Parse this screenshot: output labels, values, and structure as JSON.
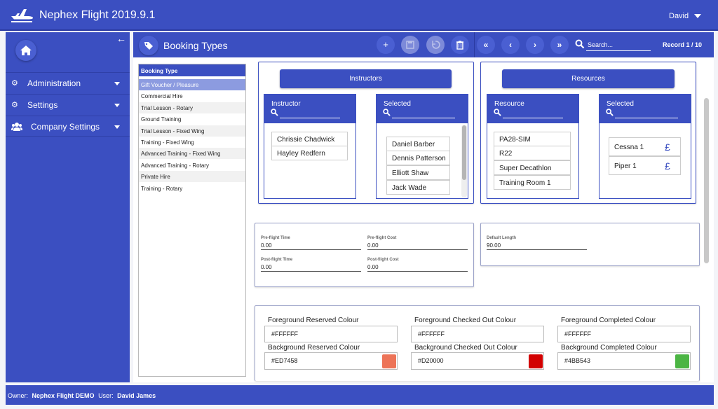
{
  "app": {
    "title": "Nephex Flight 2019.9.1",
    "user": "David"
  },
  "nav": {
    "items": [
      {
        "label": "Administration",
        "icon": "gear-icon"
      },
      {
        "label": "Settings",
        "icon": "gears-icon"
      },
      {
        "label": "Company Settings",
        "icon": "users-icon"
      }
    ]
  },
  "toolbar": {
    "title": "Booking Types",
    "search_placeholder": "Search...",
    "record": "Record 1 / 10"
  },
  "list": {
    "header": "Booking Type",
    "items": [
      "Gift Voucher / Pleasure",
      "Commercial Hire",
      "Trial Lesson - Rotary",
      "Ground Training",
      "Trial Lesson - Fixed Wing",
      "Training - Fixed Wing",
      "Advanced Training - Fixed Wing",
      "Advanced Training - Rotary",
      "Private Hire",
      "Training - Rotary"
    ]
  },
  "instructors": {
    "button": "Instructors",
    "available_header": "Instructor",
    "selected_header": "Selected",
    "available": [
      "Chrissie Chadwick",
      "Hayley Redfern"
    ],
    "selected": [
      "Daniel Barber",
      "Dennis Patterson",
      "Elliott Shaw",
      "Jack Wade"
    ]
  },
  "resources": {
    "button": "Resources",
    "available_header": "Resource",
    "selected_header": "Selected",
    "available": [
      "PA28-SIM",
      "R22",
      "Super Decathlon",
      "Training Room 1"
    ],
    "selected": [
      "Cessna 1",
      "Piper 1"
    ],
    "currency_symbol": "£"
  },
  "times": {
    "preflight_time_label": "Pre-flight Time",
    "preflight_time": "0.00",
    "preflight_cost_label": "Pre-flight Cost",
    "preflight_cost": "0.00",
    "postflight_time_label": "Post-flight Time",
    "postflight_time": "0.00",
    "postflight_cost_label": "Post-flight Cost",
    "postflight_cost": "0.00",
    "default_length_label": "Default Length",
    "default_length": "90.00"
  },
  "colours": {
    "fg_reserved_label": "Foreground Reserved Colour",
    "fg_reserved": "#FFFFFF",
    "fg_checked_label": "Foreground Checked Out Colour",
    "fg_checked": "#FFFFFF",
    "fg_completed_label": "Foreground Completed Colour",
    "fg_completed": "#FFFFFF",
    "bg_reserved_label": "Background Reserved Colour",
    "bg_reserved": "#ED7458",
    "bg_checked_label": "Background Checked Out Colour",
    "bg_checked": "#D20000",
    "bg_completed_label": "Background Completed Colour",
    "bg_completed": "#4BB543"
  },
  "footer": {
    "owner_label": "Owner:",
    "owner": "Nephex Flight DEMO",
    "user_label": "User:",
    "user": "David James"
  }
}
